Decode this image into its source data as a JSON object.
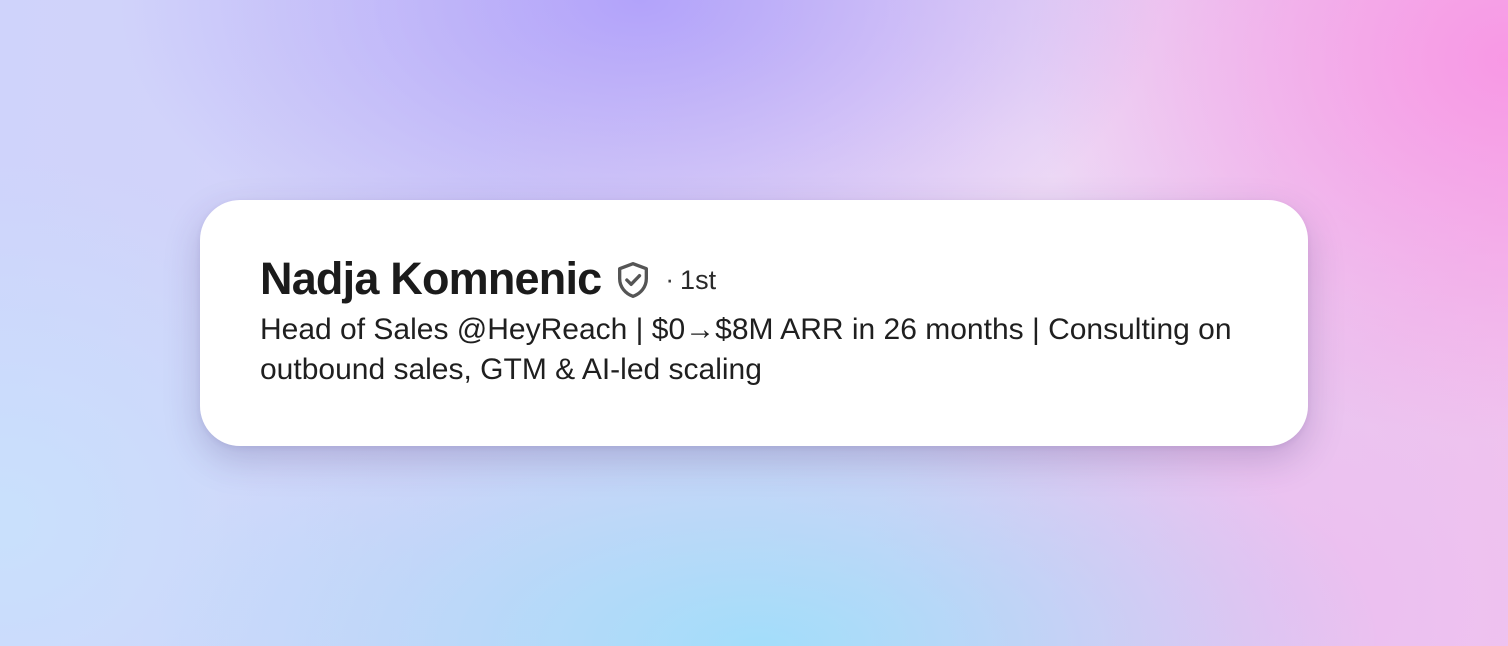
{
  "profile": {
    "name": "Nadja Komnenic",
    "badge_icon": "verified-shield-icon",
    "separator": "·",
    "connection_degree": "1st",
    "headline": "Head of Sales @HeyReach | $0→$8M ARR in 26 months | Consulting on outbound sales, GTM & AI-led scaling"
  },
  "colors": {
    "card": "#ffffff",
    "text": "#1b1b1b",
    "icon": "#555555"
  }
}
